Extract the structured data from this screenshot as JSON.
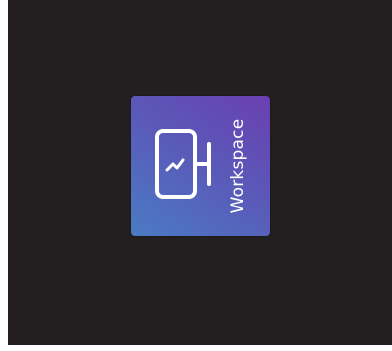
{
  "app": {
    "name": "Workspace",
    "icon": "workspace-monitor-icon"
  },
  "colors": {
    "background": "#231f20",
    "tile_gradient_start": "#4a7bc3",
    "tile_gradient_end": "#6a3fb0",
    "label": "#ffffff"
  }
}
